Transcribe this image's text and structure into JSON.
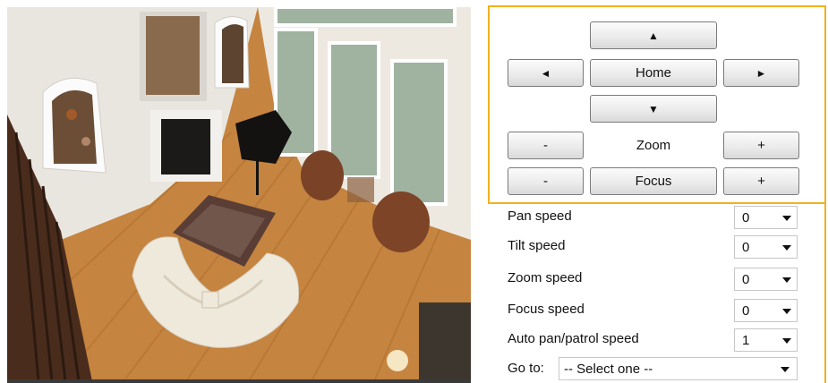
{
  "camera": {
    "image_description_icon": "living-room-camera-feed"
  },
  "ptz": {
    "up_glyph": "▲",
    "left_glyph": "◄",
    "home_label": "Home",
    "right_glyph": "►",
    "down_glyph": "▼",
    "zoom_minus": "-",
    "zoom_label": "Zoom",
    "zoom_plus": "+",
    "focus_minus": "-",
    "focus_label": "Focus",
    "focus_plus": "+"
  },
  "speeds": {
    "pan_label": "Pan speed",
    "pan_value": "0",
    "tilt_label": "Tilt speed",
    "tilt_value": "0",
    "zoom_label": "Zoom speed",
    "zoom_value": "0",
    "focus_label": "Focus speed",
    "focus_value": "0",
    "auto_label": "Auto pan/patrol speed",
    "auto_value": "1"
  },
  "goto": {
    "label": "Go to:",
    "value": "-- Select one --"
  },
  "colors": {
    "panel_border": "#f0b21b",
    "button_border": "#7a7a7a"
  }
}
